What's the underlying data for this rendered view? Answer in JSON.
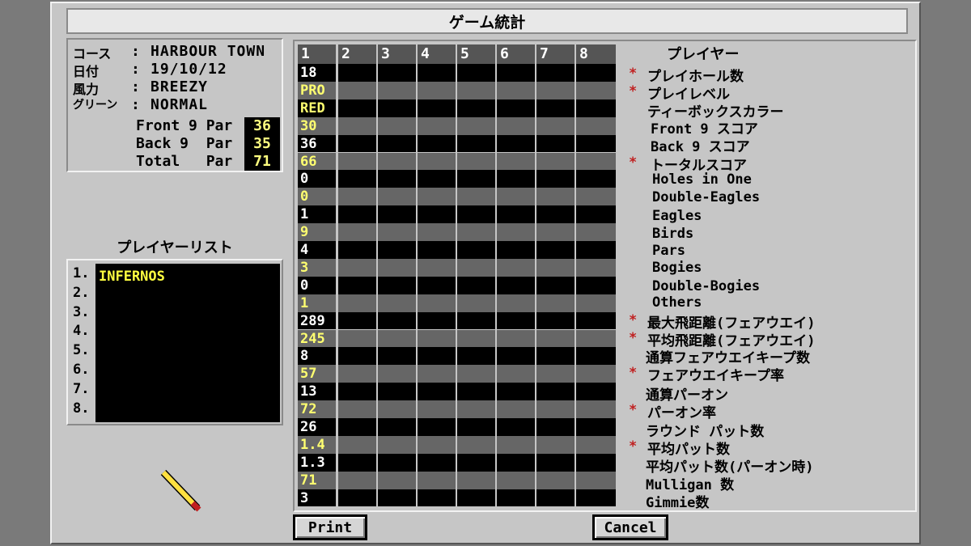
{
  "window": {
    "title": "ゲーム統計"
  },
  "course_info": {
    "rows": [
      {
        "label": "コース",
        "value": "HARBOUR TOWN"
      },
      {
        "label": "日付",
        "value": "19/10/12"
      },
      {
        "label": "風力",
        "value": "BREEZY"
      },
      {
        "label": "グリーン",
        "value": "NORMAL"
      }
    ],
    "pars": [
      {
        "label": "Front 9 Par",
        "value": "36"
      },
      {
        "label": "Back 9  Par",
        "value": "35"
      },
      {
        "label": "Total   Par",
        "value": "71"
      }
    ]
  },
  "player_list": {
    "title": "プレイヤーリスト",
    "numbers": [
      "1.",
      "2.",
      "3.",
      "4.",
      "5.",
      "6.",
      "7.",
      "8."
    ],
    "players": [
      "INFERNOS"
    ]
  },
  "grid": {
    "columns": [
      "1",
      "2",
      "3",
      "4",
      "5",
      "6",
      "7",
      "8"
    ],
    "player1_values": [
      "18",
      "PRO",
      "RED",
      "30",
      "36",
      "66",
      "0",
      "0",
      "1",
      "9",
      "4",
      "3",
      "0",
      "1",
      "289",
      "245",
      "8",
      "57",
      "13",
      "72",
      "26",
      "1.4",
      "1.3",
      "71",
      "3"
    ]
  },
  "stat_labels": {
    "title": "プレイヤー",
    "items": [
      {
        "text": "プレイホール数",
        "starred": true
      },
      {
        "text": "プレイレベル",
        "starred": true
      },
      {
        "text": "ティーボックスカラー",
        "starred": false
      },
      {
        "text": "Front 9 スコア",
        "starred": false
      },
      {
        "text": "Back 9 スコア",
        "starred": false
      },
      {
        "text": "トータルスコア",
        "starred": true
      },
      {
        "text": "Holes in One",
        "starred": false
      },
      {
        "text": "Double-Eagles",
        "starred": false
      },
      {
        "text": "Eagles",
        "starred": false
      },
      {
        "text": "Birds",
        "starred": false
      },
      {
        "text": "Pars",
        "starred": false
      },
      {
        "text": "Bogies",
        "starred": false
      },
      {
        "text": "Double-Bogies",
        "starred": false
      },
      {
        "text": "Others",
        "starred": false
      },
      {
        "text": "最大飛距離(フェアウエイ)",
        "starred": true
      },
      {
        "text": "平均飛距離(フェアウエイ)",
        "starred": true
      },
      {
        "text": "通算フェアウエイキープ数",
        "starred": false
      },
      {
        "text": "フェアウエイキープ率",
        "starred": true
      },
      {
        "text": "通算パーオン",
        "starred": false
      },
      {
        "text": "パーオン率",
        "starred": true
      },
      {
        "text": "ラウンド パット数",
        "starred": false
      },
      {
        "text": "平均パット数",
        "starred": true
      },
      {
        "text": "平均パット数(パーオン時)",
        "starred": false
      },
      {
        "text": "Mulligan 数",
        "starred": false
      },
      {
        "text": "Gimmie数",
        "starred": false
      }
    ]
  },
  "buttons": {
    "print": "Print",
    "cancel": "Cancel"
  },
  "colors": {
    "value_white": "#ffffff",
    "value_yellow": "#ffff70",
    "star": "#c02020"
  }
}
